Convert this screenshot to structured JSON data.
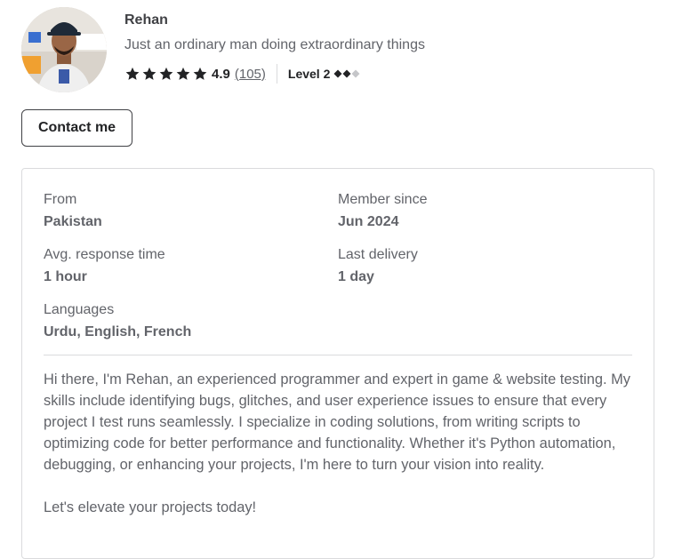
{
  "profile": {
    "name": "Rehan",
    "tagline": "Just an ordinary man doing extraordinary things",
    "rating": "4.9",
    "review_count": "(105)",
    "stars_filled": 5,
    "level": "Level 2",
    "level_diamonds_filled": 2,
    "level_diamonds_total": 3
  },
  "actions": {
    "contact_label": "Contact me"
  },
  "stats": {
    "from_label": "From",
    "from_value": "Pakistan",
    "member_label": "Member since",
    "member_value": "Jun 2024",
    "response_label": "Avg. response time",
    "response_value": "1 hour",
    "delivery_label": "Last delivery",
    "delivery_value": "1 day",
    "languages_label": "Languages",
    "languages_value": "Urdu, English, French"
  },
  "description": {
    "paragraph1": "Hi there, I'm Rehan, an experienced programmer and expert in game & website testing. My skills include identifying bugs, glitches, and user experience issues to ensure that every project I test runs seamlessly. I specialize in coding solutions, from writing scripts to optimizing code for better performance and functionality. Whether it's Python automation, debugging, or enhancing your projects, I'm here to turn your vision into reality.",
    "paragraph2": "Let's elevate your projects today!"
  },
  "colors": {
    "text_dark": "#222325",
    "text_muted": "#62646a",
    "border": "#dadbdd",
    "diamond_empty": "#c5c6c9"
  }
}
